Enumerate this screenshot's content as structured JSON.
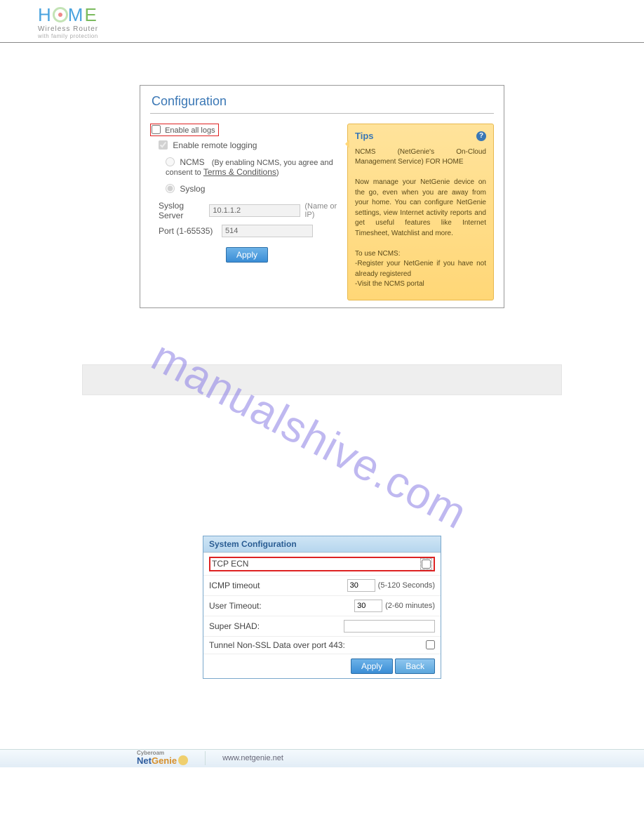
{
  "logo": {
    "sub1": "Wireless  Router",
    "sub2": "with family protection"
  },
  "panel1": {
    "title": "Configuration",
    "enable_all_logs": "Enable all logs",
    "enable_remote": "Enable remote logging",
    "ncms_label": "NCMS",
    "ncms_note_prefix": "(By enabling NCMS, you agree and consent to ",
    "ncms_terms": "Terms & Conditions",
    "ncms_note_suffix": ")",
    "syslog_label": "Syslog",
    "syslog_server_label": "Syslog Server",
    "syslog_server_value": "10.1.1.2",
    "syslog_server_hint": "(Name or IP)",
    "port_label": "Port (1-65535)",
    "port_value": "514",
    "apply": "Apply"
  },
  "tips": {
    "title": "Tips",
    "p1": "NCMS (NetGenie's On-Cloud Management Service) FOR HOME",
    "p2": "Now manage your NetGenie device on the go, even when you are away from your home. You can configure NetGenie settings, view Internet activity reports and get useful features like Internet Timesheet, Watchlist and more.",
    "p3": "To use NCMS:",
    "p4": "-Register your NetGenie if you have not already registered",
    "p5": "-Visit the NCMS portal"
  },
  "watermark": "manualshive.com",
  "panel2": {
    "title": "System Configuration",
    "tcp_ecn": "TCP ECN",
    "icmp_label": "ICMP timeout",
    "icmp_value": "30",
    "icmp_hint": "(5-120 Seconds)",
    "user_label": "User Timeout:",
    "user_value": "30",
    "user_hint": "(2-60 minutes)",
    "shad_label": "Super SHAD:",
    "tunnel_label": "Tunnel Non-SSL Data over port 443:",
    "apply": "Apply",
    "back": "Back"
  },
  "footer": {
    "cyberoam": "Cyberoam",
    "brand": "NetGenie",
    "url": "www.netgenie.net"
  }
}
